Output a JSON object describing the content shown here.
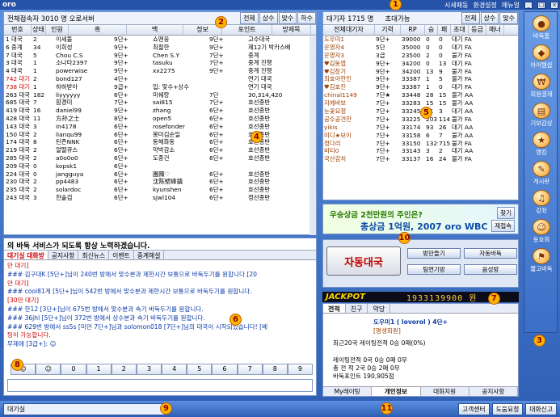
{
  "titlebar": {
    "logo": "oro",
    "menu": [
      "시세패동",
      "환경설정",
      "매뉴얼"
    ],
    "win_buttons": [
      "_",
      "□",
      "×"
    ]
  },
  "markers": [
    "1",
    "2",
    "3",
    "4",
    "5",
    "6",
    "7",
    "8",
    "9",
    "10",
    "11"
  ],
  "room_panel": {
    "header_label": "전체접속자 3010 명  오로서버",
    "filter_buttons": [
      "전체",
      "상수",
      "맞수",
      "하수"
    ],
    "columns": [
      "번호",
      "상태",
      "인원",
      "흑",
      "백",
      "정보",
      "포인트",
      "방제목"
    ],
    "rows": [
      [
        "1 대국",
        "2",
        "이세돌",
        "9단+",
        "쇼맨웅",
        "9단+",
        "고수대국"
      ],
      [
        "6 중계",
        "34",
        "이희성",
        "9단+",
        "최철한",
        "9단+",
        "제12기 박카스배"
      ],
      [
        "7 대국",
        "5",
        "Chou C.S",
        "9단+",
        "Chen S.Y",
        "7단+",
        "중계"
      ],
      [
        "3 대국",
        "1",
        "소나타2397",
        "9단+",
        "tasuku",
        "7단+",
        "중계 진행"
      ],
      [
        "4 대국",
        "1",
        "powerwise",
        "9단+",
        "xx2275",
        "9단+",
        "중계 진행"
      ],
      [
        "742 대기",
        "2",
        "bond127",
        "4단+",
        "",
        "",
        "연기 대국"
      ],
      [
        "738 대기",
        "1",
        "하하받아",
        "9급+",
        "입: 맞수+상수",
        "",
        "연기 대국"
      ],
      [
        "263 대국",
        "182",
        "liyyyyyy",
        "6단+",
        "미쉐랑",
        "7단",
        "30,314,420"
      ],
      [
        "685 대국",
        "7",
        "함경미",
        "7단+",
        "sai815",
        "7단+",
        "호선종반"
      ],
      [
        "419 대국",
        "16",
        "daniel99",
        "9단+",
        "zhang",
        "6단+",
        "호선종반"
      ],
      [
        "428 대국",
        "11",
        "方孙之士",
        "8단+",
        "open5",
        "6단+",
        "호선종반"
      ],
      [
        "143 대국",
        "3",
        "in4178",
        "6단+",
        "rosefonder",
        "6단+",
        "호선종반"
      ],
      [
        "150 대국",
        "2",
        "lianqu99",
        "6단+",
        "봉미김순일",
        "6단+",
        "호선종반"
      ],
      [
        "174 대국",
        "8",
        "틴즌NNK",
        "6단+",
        "동해화동",
        "6단+",
        "호선종반"
      ],
      [
        "219 대국",
        "2",
        "얼떨뀨스",
        "6단+",
        "악박감소",
        "6단+",
        "호선종반"
      ],
      [
        "285 대국",
        "2",
        "a0o0o0",
        "6단+",
        "도중건",
        "6단+",
        "호선종반"
      ],
      [
        "209 대국",
        "0",
        "kopsk1",
        "6단+",
        "",
        "",
        ""
      ],
      [
        "224 대국",
        "0",
        "jangguya",
        "6단+",
        "園陳♡",
        "6단+",
        "호선종반"
      ],
      [
        "230 대국",
        "2",
        "pp4483",
        "6단+",
        "沈陈壁峰鎮",
        "6단+",
        "호선종반"
      ],
      [
        "235 대국",
        "2",
        "solardoc",
        "6단+",
        "kyunshen",
        "6단+",
        "호선종반"
      ],
      [
        "243 대국",
        "3",
        "한솔검",
        "6단+",
        "sjwl104",
        "6단+",
        "정선종반"
      ]
    ]
  },
  "wait_panel": {
    "header_label": "대기자 1715 명",
    "toggle_label": "초대가능",
    "filter_buttons": [
      "전체",
      "상수",
      "맞수"
    ],
    "columns": [
      "전체대기자",
      "기력",
      "RP",
      "승",
      "패",
      "초대",
      "등급",
      "매너"
    ],
    "rows": [
      [
        "도우미1",
        "9단+",
        "39000",
        "0",
        "0",
        "대기",
        "FA"
      ],
      [
        "운영자4",
        "5단",
        "35000",
        "0",
        "0",
        "대기",
        "FA"
      ],
      [
        "운영자3",
        "3급",
        "23500",
        "2",
        "0",
        "불가",
        "FA"
      ],
      [
        "♥김동엽",
        "9단+",
        "34200",
        "0",
        "13",
        "대기",
        "FA"
      ],
      [
        "♥김창기",
        "9단+",
        "34200",
        "13",
        "9",
        "불가",
        "FA"
      ],
      [
        "최호아한인",
        "9단+",
        "33387",
        "1",
        "5",
        "불가",
        "FA"
      ],
      [
        "♥김호진",
        "9단+",
        "33387",
        "1",
        "0",
        "대기",
        "FA"
      ],
      [
        "chinal1149",
        "7단★",
        "33448",
        "28",
        "15",
        "불가",
        "AA"
      ],
      [
        "지예바보",
        "7단+",
        "33283",
        "15",
        "15",
        "불가",
        "AA"
      ],
      [
        "눈꽃요정",
        "7단+",
        "33245",
        "21",
        "3",
        "대기",
        "AA"
      ],
      [
        "공수공견한",
        "7단+",
        "33225",
        "203",
        "114",
        "불가",
        "FA"
      ],
      [
        "yikis",
        "7단+",
        "33174",
        "93",
        "26",
        "대기",
        "AA"
      ],
      [
        "미디★보이",
        "7단+",
        "33158",
        "6",
        "7",
        "불가",
        "AA"
      ],
      [
        "정다리",
        "7단+",
        "33150",
        "1329",
        "715",
        "불가",
        "FA"
      ],
      [
        "비티0",
        "7단+",
        "33143",
        "3",
        "2",
        "대기",
        "AA"
      ],
      [
        "국산감치",
        "7단+",
        "33137",
        "16",
        "24",
        "불가",
        "FA"
      ]
    ]
  },
  "iconbar": [
    "바둑홈",
    "아이템샵",
    "회원결제",
    "기보감상",
    "랭킹",
    "게시판",
    "강좌",
    "동호회",
    "짧고바둑"
  ],
  "banner": {
    "line1": "우승상금 2천만원의 주인은?",
    "line2": "총상금 1억원, 2007 oro WBC",
    "find_btn": "찾기",
    "refresh_btn": "재접속"
  },
  "quick": {
    "auto_label": "자동대국",
    "buttons": [
      "방만들기",
      "자동바둑",
      "팀연기방",
      "음성방"
    ]
  },
  "jackpot": {
    "label": "JACKPOT",
    "value": "1933139900 원"
  },
  "profile": {
    "tabs": [
      "전적",
      "친구",
      "악당"
    ],
    "name": "도우미1 ( lovorol ) 4단+",
    "tier": "[명생회원]",
    "recent": "최근20국 레이팅전적     0승     0패(0%)",
    "rating_lines": [
      "레이팅전적     0국    0승    0패     0무",
      "총  전  적     2국    0승    2패     0무"
    ],
    "points": "바둑포인트  190,905점",
    "bottom_tabs": [
      "My레이팅",
      "개인정보",
      "대화지원",
      "공지사항"
    ]
  },
  "chat": {
    "notice": "의 바둑 서비스가 되도록 항상 노력하겠습니다.",
    "tabs": [
      "대기실 대화방",
      "공지사항",
      "최신뉴스",
      "이벤트",
      "중계해설"
    ],
    "lines": [
      {
        "cls": "r",
        "text": "만 대기]"
      },
      {
        "cls": "b",
        "text": "### 김구대K [5단+]님이 240번 방에서 맞수분과 제한시간 보통으로 바둑두기를 원합니다.[20"
      },
      {
        "cls": "r",
        "text": "만 대기]"
      },
      {
        "cls": "b",
        "text": "### cool81게 [5단+]님이 542번 방에서 맞수분과 제한시간 보통으로 바둑두기를 원합니다."
      },
      {
        "cls": "r",
        "text": "[30만 대기]"
      },
      {
        "cls": "b",
        "text": "### 한12 [3단+]님이 675번 방에서 맞수분과 속기 바둑두기를 원합니다."
      },
      {
        "cls": "b",
        "text": "### 36jhl [5단+]님이 372번 방에서 상수분과 속기 바둑두기를 원합니다."
      },
      {
        "cls": "b",
        "text": "### 629번 방에서 ss5s [미만 7단+]님과 solomon018 [7단+]님의 대국이 시작되었습니다! [베"
      },
      {
        "cls": "r",
        "text": "팅이 가능합니다."
      },
      {
        "cls": "b",
        "text": "   무제애 [3급+]: ☺"
      }
    ],
    "numbar": [
      "☺",
      "☺",
      "0",
      "1",
      "2",
      "3",
      "4",
      "5",
      "6",
      "7",
      "8",
      "9"
    ]
  },
  "statusbar": {
    "channel": "대기실",
    "buttons": [
      "고객센터",
      "도움요청",
      "대화신고"
    ]
  }
}
